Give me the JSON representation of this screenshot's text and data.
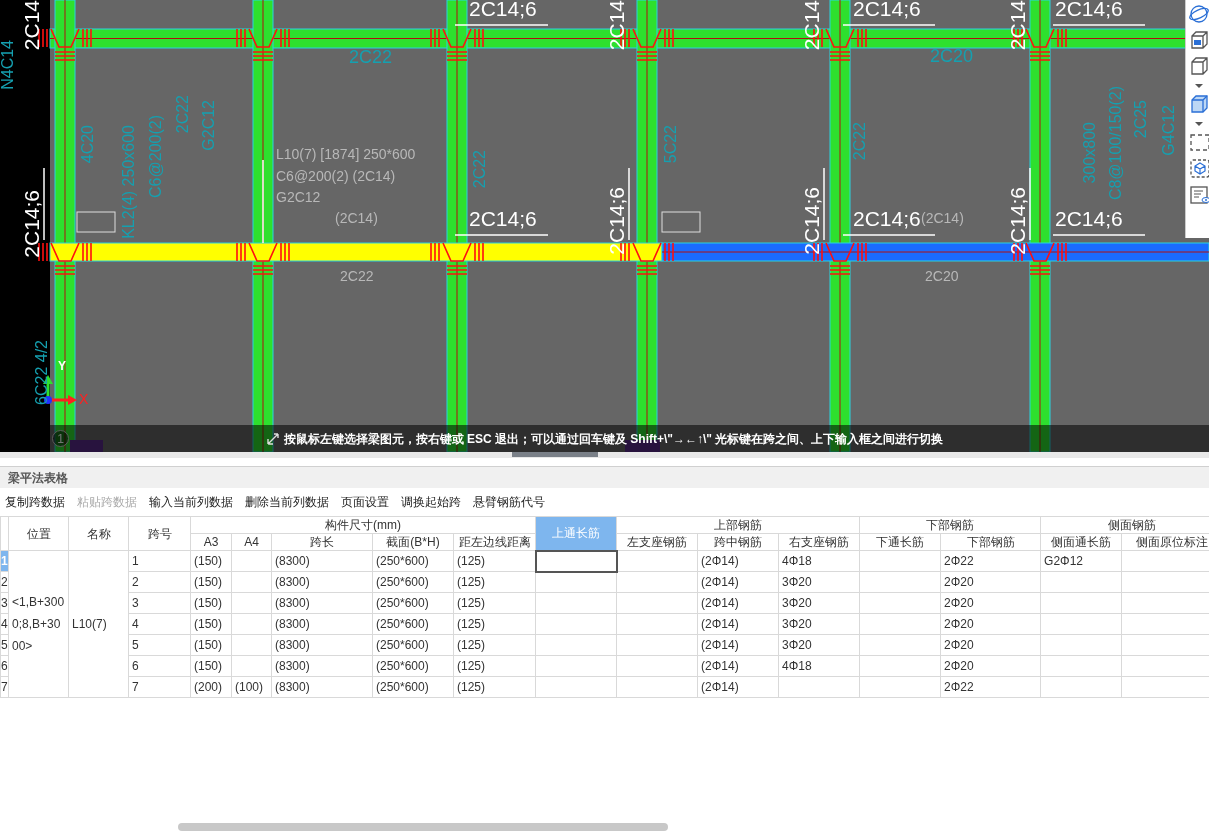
{
  "canvas": {
    "labels": [
      {
        "text": "2C14;6",
        "kind": "callout"
      },
      {
        "text": "2C14;6",
        "kind": "callout"
      },
      {
        "text": "2C14;6",
        "kind": "callout"
      },
      {
        "text": "2C14;6",
        "kind": "callout"
      },
      {
        "text": "2C14;6",
        "kind": "callout"
      },
      {
        "text": "2C14;6",
        "kind": "callout"
      },
      {
        "text": "2C14",
        "kind": "vertical-callout"
      },
      {
        "text": "2C14",
        "kind": "vertical-callout"
      },
      {
        "text": "2C14",
        "kind": "vertical-callout"
      },
      {
        "text": "2C14",
        "kind": "vertical-callout"
      },
      {
        "text": "2C14;6",
        "kind": "vertical-callout"
      },
      {
        "text": "2C14;6",
        "kind": "vertical-callout"
      },
      {
        "text": "2C14;6",
        "kind": "vertical-callout"
      },
      {
        "text": "2C14;6",
        "kind": "vertical-callout"
      },
      {
        "text": "L10(7) [1874] 250*600",
        "kind": "note"
      },
      {
        "text": "C6@200(2) (2C14)",
        "kind": "note"
      },
      {
        "text": "G2C12",
        "kind": "note"
      },
      {
        "text": "(2C14)",
        "kind": "note"
      },
      {
        "text": "(2C14)",
        "kind": "note"
      },
      {
        "text": "2C22",
        "kind": "note"
      },
      {
        "text": "2C20",
        "kind": "note"
      },
      {
        "text": "2C22",
        "kind": "dimension"
      },
      {
        "text": "2C20",
        "kind": "dimension"
      },
      {
        "text": "N4C14",
        "kind": "vertical-dimension"
      },
      {
        "text": "4C20",
        "kind": "vertical-dimension"
      },
      {
        "text": "KL2(4) 250x600",
        "kind": "vertical-dimension"
      },
      {
        "text": "C6@200(2)",
        "kind": "vertical-dimension"
      },
      {
        "text": "2C22",
        "kind": "vertical-dimension"
      },
      {
        "text": "G2C12",
        "kind": "vertical-dimension"
      },
      {
        "text": "2C22",
        "kind": "vertical-dimension"
      },
      {
        "text": "5C22",
        "kind": "vertical-dimension"
      },
      {
        "text": "2C22",
        "kind": "vertical-dimension"
      },
      {
        "text": "300x800",
        "kind": "vertical-dimension"
      },
      {
        "text": "C8@100/150(2)",
        "kind": "vertical-dimension"
      },
      {
        "text": "2C25",
        "kind": "vertical-dimension"
      },
      {
        "text": "G4C12",
        "kind": "vertical-dimension"
      },
      {
        "text": "6C22 4/2",
        "kind": "vertical-dimension"
      }
    ],
    "axis": {
      "x_label": "X",
      "y_label": "Y"
    },
    "layer_tab": "1",
    "status_hint": "按鼠标左键选择梁图元，按右键或 ESC 退出；可以通过回车键及 Shift+\\\"→←↑\\\" 光标键在跨之间、上下输入框之间进行切换"
  },
  "panel": {
    "title": "梁平法表格",
    "toolbar": [
      {
        "label": "复制跨数据",
        "disabled": false
      },
      {
        "label": "粘贴跨数据",
        "disabled": true
      },
      {
        "label": "输入当前列数据",
        "disabled": false
      },
      {
        "label": "删除当前列数据",
        "disabled": false
      },
      {
        "label": "页面设置",
        "disabled": false
      },
      {
        "label": "调换起始跨",
        "disabled": false
      },
      {
        "label": "悬臂钢筋代号",
        "disabled": false
      }
    ],
    "table": {
      "header": [
        {
          "label": "位置",
          "selected": false
        },
        {
          "label": "名称",
          "selected": false
        },
        {
          "label": "跨号",
          "selected": false
        },
        {
          "label": "构件尺寸(mm)",
          "selected": false,
          "children": [
            {
              "label": "A3",
              "selected": false
            },
            {
              "label": "A4",
              "selected": false
            },
            {
              "label": "跨长",
              "selected": false
            },
            {
              "label": "截面(B*H)",
              "selected": false
            },
            {
              "label": "距左边线距离",
              "selected": false
            }
          ]
        },
        {
          "label": "上通长筋",
          "selected": true
        },
        {
          "label": "上部钢筋",
          "selected": false,
          "children": [
            {
              "label": "左支座钢筋",
              "selected": false
            },
            {
              "label": "跨中钢筋",
              "selected": false
            },
            {
              "label": "右支座钢筋",
              "selected": false
            }
          ]
        },
        {
          "label": "下部钢筋",
          "selected": false,
          "children": [
            {
              "label": "下通长筋",
              "selected": false
            },
            {
              "label": "下部钢筋",
              "selected": false
            }
          ]
        },
        {
          "label": "侧面钢筋",
          "selected": false,
          "children": [
            {
              "label": "侧面通长筋",
              "selected": false
            },
            {
              "label": "侧面原位标注",
              "selected": false
            }
          ]
        }
      ],
      "position": "<1,B+3000;8,B+3000>",
      "name": "L10(7)",
      "rows": [
        {
          "row": "1",
          "selected": true,
          "span": "1",
          "a3": "(150)",
          "span_length": "(8300)",
          "section": "(250*600)",
          "edge_distance": "(125)",
          "mid_span": "(2Φ14)",
          "right_support": "4Φ18",
          "bottom": "2Φ22",
          "side_through": "G2Φ12"
        },
        {
          "row": "2",
          "selected": false,
          "span": "2",
          "a3": "(150)",
          "span_length": "(8300)",
          "section": "(250*600)",
          "edge_distance": "(125)",
          "mid_span": "(2Φ14)",
          "right_support": "3Φ20",
          "bottom": "2Φ20"
        },
        {
          "row": "3",
          "selected": false,
          "span": "3",
          "a3": "(150)",
          "span_length": "(8300)",
          "section": "(250*600)",
          "edge_distance": "(125)",
          "mid_span": "(2Φ14)",
          "right_support": "3Φ20",
          "bottom": "2Φ20"
        },
        {
          "row": "4",
          "selected": false,
          "span": "4",
          "a3": "(150)",
          "span_length": "(8300)",
          "section": "(250*600)",
          "edge_distance": "(125)",
          "mid_span": "(2Φ14)",
          "right_support": "3Φ20",
          "bottom": "2Φ20"
        },
        {
          "row": "5",
          "selected": false,
          "span": "5",
          "a3": "(150)",
          "span_length": "(8300)",
          "section": "(250*600)",
          "edge_distance": "(125)",
          "mid_span": "(2Φ14)",
          "right_support": "3Φ20",
          "bottom": "2Φ20"
        },
        {
          "row": "6",
          "selected": false,
          "span": "6",
          "a3": "(150)",
          "span_length": "(8300)",
          "section": "(250*600)",
          "edge_distance": "(125)",
          "mid_span": "(2Φ14)",
          "right_support": "4Φ18",
          "bottom": "2Φ20"
        },
        {
          "row": "7",
          "selected": false,
          "span": "7",
          "a3": "(200)",
          "a4": "(100)",
          "span_length": "(8300)",
          "section": "(250*600)",
          "edge_distance": "(125)",
          "mid_span": "(2Φ14)",
          "bottom": "2Φ22"
        }
      ]
    }
  }
}
